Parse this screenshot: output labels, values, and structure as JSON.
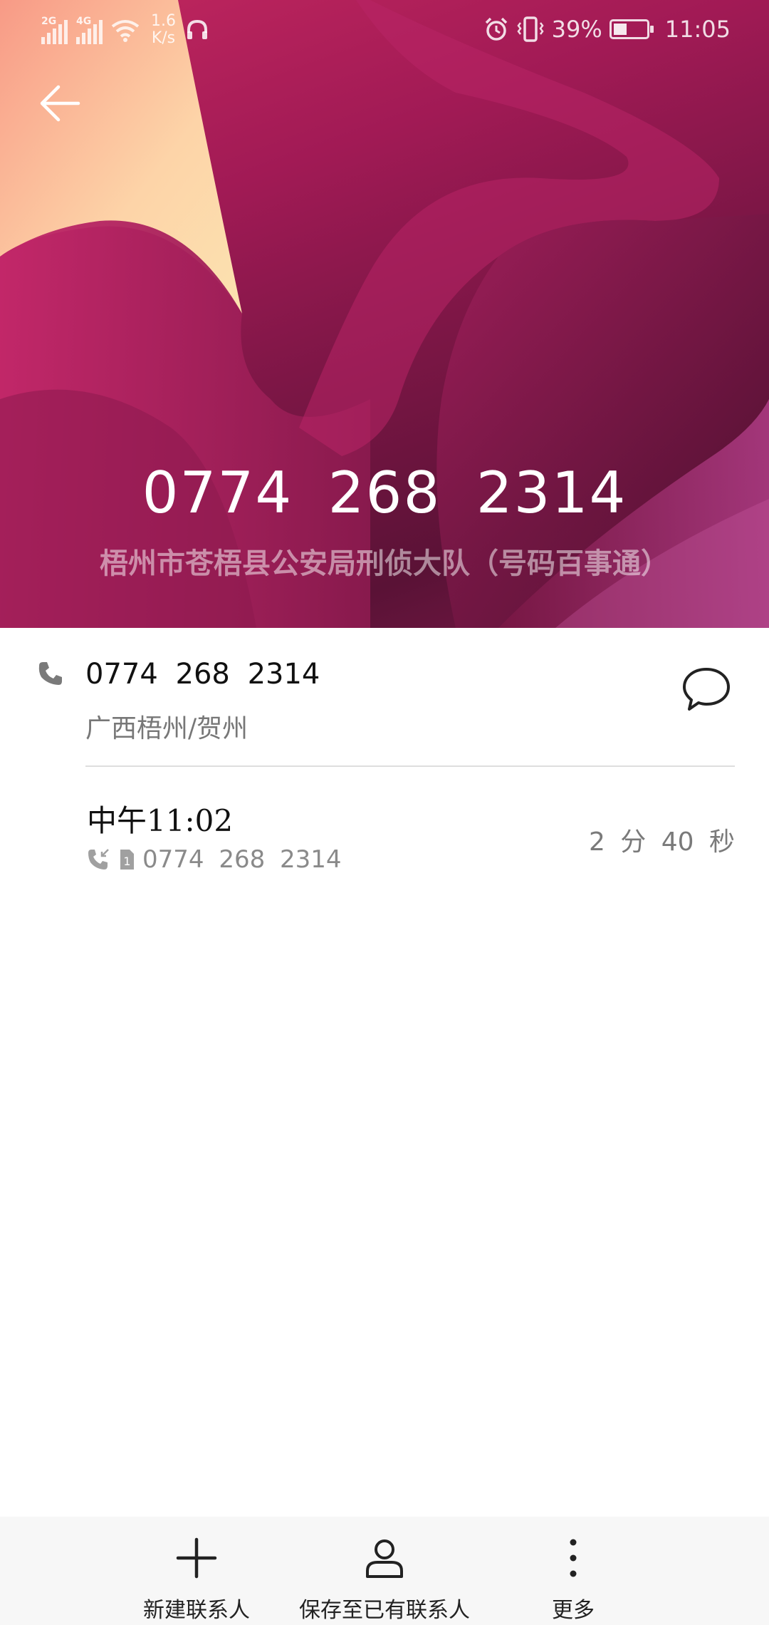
{
  "status_bar": {
    "signal_1": "2G",
    "signal_2": "4G",
    "net_speed_value": "1.6",
    "net_speed_unit": "K/s",
    "battery_percent": "39%",
    "battery_level": 0.39,
    "time": "11:05"
  },
  "header": {
    "number": "0774 268 2314",
    "description": "梧州市苍梧县公安局刑侦大队（号码百事通）"
  },
  "phone_entry": {
    "number": "0774 268 2314",
    "location": "广西梧州/贺州"
  },
  "call_log": [
    {
      "time": "中午11:02",
      "number": "0774 268 2314",
      "sim": "1",
      "duration": "2 分 40 秒"
    }
  ],
  "bottom_bar": {
    "new_contact": "新建联系人",
    "save_existing": "保存至已有联系人",
    "more": "更多"
  },
  "colors": {
    "header_primary": "#a11a55",
    "header_dark": "#5a1236",
    "header_peach": "#fbc9a0"
  },
  "icons": [
    "back-arrow-icon",
    "phone-icon",
    "message-icon",
    "incoming-call-icon",
    "sim-icon",
    "plus-icon",
    "person-icon",
    "more-vertical-icon",
    "alarm-icon",
    "vibrate-icon",
    "headset-icon",
    "wifi-icon"
  ]
}
